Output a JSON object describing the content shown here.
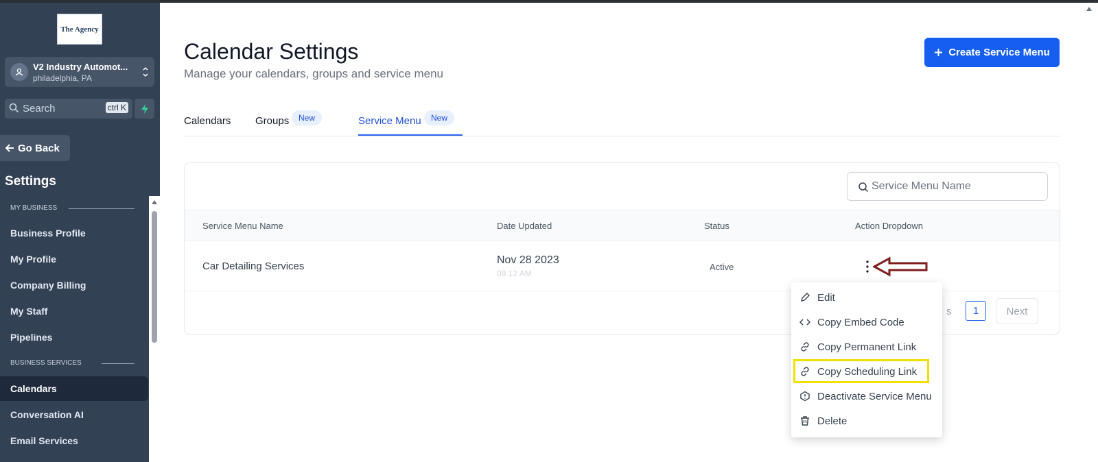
{
  "sidebar": {
    "logo_text": "The Agency",
    "account": {
      "name": "V2 Industry Automot...",
      "location": "philadelphia, PA"
    },
    "search": {
      "placeholder": "Search",
      "shortcut": "ctrl K"
    },
    "go_back": "Go Back",
    "title": "Settings",
    "sections": [
      {
        "label": "MY BUSINESS",
        "items": [
          "Business Profile",
          "My Profile",
          "Company Billing",
          "My Staff",
          "Pipelines"
        ]
      },
      {
        "label": "BUSINESS SERVICES",
        "items": [
          "Calendars",
          "Conversation AI",
          "Email Services"
        ]
      }
    ],
    "active_item": "Calendars"
  },
  "header": {
    "title": "Calendar Settings",
    "subtitle": "Manage your calendars, groups and service menu",
    "create_button": "Create Service Menu"
  },
  "tabs": [
    {
      "label": "Calendars",
      "badge": ""
    },
    {
      "label": "Groups",
      "badge": "New"
    },
    {
      "label": "Service Menu",
      "badge": "New",
      "active": true
    }
  ],
  "table": {
    "search_placeholder": "Service Menu Name",
    "columns": [
      "Service Menu Name",
      "Date Updated",
      "Status",
      "Action Dropdown"
    ],
    "rows": [
      {
        "name": "Car Detailing Services",
        "date": "Nov 28 2023",
        "time": "08 12 AM",
        "status": "Active"
      }
    ],
    "pagination": {
      "prev": "s",
      "current": "1",
      "next": "Next"
    }
  },
  "dropdown": {
    "items": [
      "Edit",
      "Copy Embed Code",
      "Copy Permanent Link",
      "Copy Scheduling Link",
      "Deactivate Service Menu",
      "Delete"
    ],
    "highlighted": "Copy Scheduling Link"
  },
  "colors": {
    "sidebar_bg": "#334155",
    "accent": "#155eef",
    "highlight": "#f1e000",
    "arrow": "#7f1d1d"
  }
}
